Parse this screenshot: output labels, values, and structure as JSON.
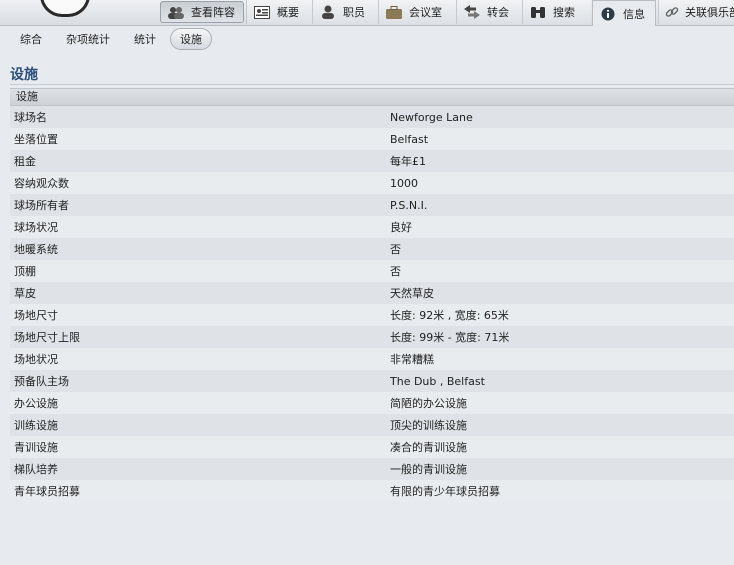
{
  "tabs": [
    {
      "label": "查看阵容",
      "icon": "people-icon"
    },
    {
      "label": "概要",
      "icon": "id-card-icon"
    },
    {
      "label": "职员",
      "icon": "person-icon"
    },
    {
      "label": "会议室",
      "icon": "briefcase-icon"
    },
    {
      "label": "转会",
      "icon": "arrows-icon"
    },
    {
      "label": "搜索",
      "icon": "binoculars-icon"
    },
    {
      "label": "信息",
      "icon": "info-icon"
    },
    {
      "label": "关联俱乐部",
      "icon": "link-icon"
    }
  ],
  "subtabs": [
    "综合",
    "杂项统计",
    "统计",
    "设施"
  ],
  "section_title": "设施",
  "table_header": "设施",
  "rows": [
    {
      "label": "球场名",
      "value": "Newforge Lane"
    },
    {
      "label": "坐落位置",
      "value": "Belfast"
    },
    {
      "label": "租金",
      "value": "每年£1"
    },
    {
      "label": "容纳观众数",
      "value": "1000"
    },
    {
      "label": "球场所有者",
      "value": "P.S.N.I."
    },
    {
      "label": "球场状况",
      "value": "良好"
    },
    {
      "label": "地暖系统",
      "value": "否"
    },
    {
      "label": "顶棚",
      "value": "否"
    },
    {
      "label": "草皮",
      "value": "天然草皮"
    },
    {
      "label": "场地尺寸",
      "value": "长度: 92米 , 宽度: 65米"
    },
    {
      "label": "场地尺寸上限",
      "value": "长度: 99米 - 宽度: 71米"
    },
    {
      "label": "场地状况",
      "value": "非常糟糕"
    },
    {
      "label": "预备队主场",
      "value": "The Dub , Belfast"
    },
    {
      "label": "办公设施",
      "value": "简陋的办公设施"
    },
    {
      "label": "训练设施",
      "value": "顶尖的训练设施"
    },
    {
      "label": "青训设施",
      "value": "凑合的青训设施"
    },
    {
      "label": "梯队培养",
      "value": "一般的青训设施"
    },
    {
      "label": "青年球员招募",
      "value": "有限的青少年球员招募"
    }
  ]
}
